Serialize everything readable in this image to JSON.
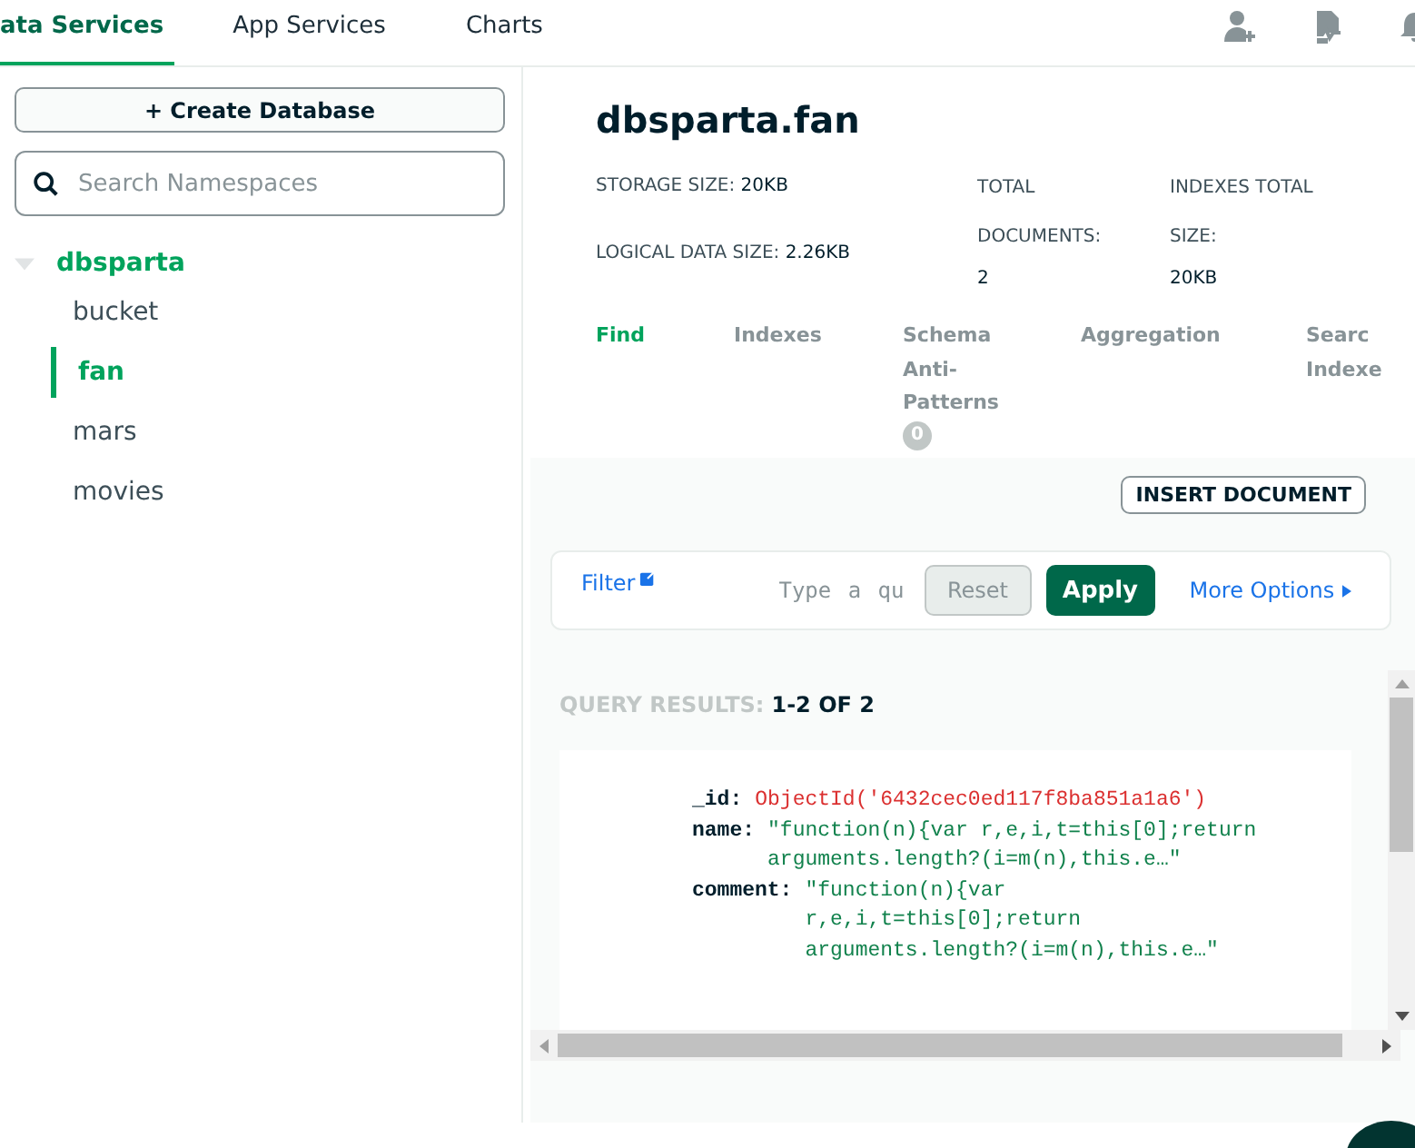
{
  "nav": {
    "tabs": [
      {
        "label": "ata Services",
        "selected": true
      },
      {
        "label": "App Services",
        "selected": false
      },
      {
        "label": "Charts",
        "selected": false
      }
    ]
  },
  "sidebar": {
    "create_button": "+ Create Database",
    "search": {
      "placeholder": "Search Namespaces"
    },
    "tree": [
      {
        "label": "dbsparta",
        "expanded": true,
        "children": [
          {
            "label": "bucket",
            "selected": false
          },
          {
            "label": "fan",
            "selected": true
          },
          {
            "label": "mars",
            "selected": false
          },
          {
            "label": "movies",
            "selected": false
          }
        ]
      }
    ]
  },
  "collection": {
    "title": "dbsparta.fan",
    "stats": [
      {
        "kind": "inline",
        "label": "STORAGE SIZE:",
        "value": "20KB"
      },
      {
        "kind": "inline",
        "label": "LOGICAL DATA SIZE:",
        "value": "2.26KB"
      },
      {
        "kind": "stacked",
        "label": "TOTAL DOCUMENTS:",
        "value": "2"
      },
      {
        "kind": "stacked",
        "label": "INDEXES TOTAL SIZE:",
        "value": "20KB"
      }
    ],
    "tabs": [
      {
        "label": "Find",
        "selected": true
      },
      {
        "label": "Indexes",
        "selected": false
      },
      {
        "label": "Schema Anti-Patterns",
        "selected": false,
        "badge": "0"
      },
      {
        "label": "Aggregation",
        "selected": false
      },
      {
        "label": "Searc Indexe",
        "selected": false
      }
    ]
  },
  "toolbar": {
    "insert_button": "INSERT DOCUMENT",
    "filter_label": "Filter",
    "query_placeholder": "Type a qu",
    "reset_button": "Reset",
    "apply_button": "Apply",
    "more_options": "More Options"
  },
  "results": {
    "label": "QUERY RESULTS:",
    "count": "1-2 OF 2",
    "fields": [
      {
        "key": "_id:",
        "kind": "objectid",
        "value": "ObjectId('6432cec0ed117f8ba851a1a6')"
      },
      {
        "key": "name:",
        "kind": "string",
        "value": "\"function(n){var r,e,i,t=this[0];return arguments.length?(i=m(n),this.e…\""
      },
      {
        "key": "comment:",
        "kind": "string",
        "value": "\"function(n){var r,e,i,t=this[0];return arguments.length?(i=m(n),this.e…\""
      }
    ]
  }
}
